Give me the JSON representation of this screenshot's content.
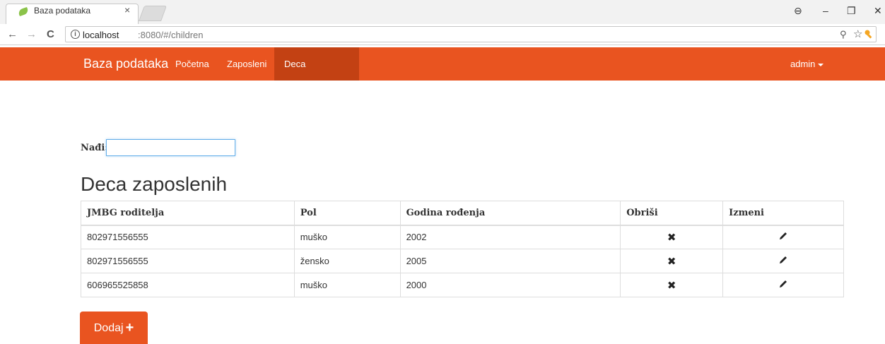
{
  "browser": {
    "tab_title": "Baza podataka",
    "tab_close": "×",
    "url_host": "localhost",
    "url_path": ":8080/#/children",
    "info_glyph": "i",
    "back_icon": "←",
    "forward_icon": "→",
    "reload_icon": "C",
    "key_icon": "⚲",
    "star_icon": "☆",
    "window_minimize": "–",
    "window_restore": "❐",
    "window_close": "✕",
    "profile_icon": "⊖"
  },
  "navbar": {
    "brand": "Baza podataka",
    "links": [
      "Početna",
      "Zaposleni",
      "Deca zaposlenih"
    ],
    "active_index": 2,
    "user": "admin",
    "color": "#e95420",
    "active_color": "#c34113"
  },
  "search": {
    "label": "Nađi:",
    "value": ""
  },
  "page_title": "Deca zaposlenih",
  "table": {
    "headers": [
      "JMBG roditelja",
      "Pol",
      "Godina rođenja",
      "Obriši",
      "Izmeni"
    ],
    "rows": [
      [
        "802971556555",
        "muško",
        "2002"
      ],
      [
        "802971556555",
        "žensko",
        "2005"
      ],
      [
        "606965525858",
        "muško",
        "2000"
      ]
    ],
    "delete_icon": "✖",
    "edit_icon": "pencil-icon"
  },
  "add_button": {
    "label": "Dodaj",
    "icon": "+"
  }
}
